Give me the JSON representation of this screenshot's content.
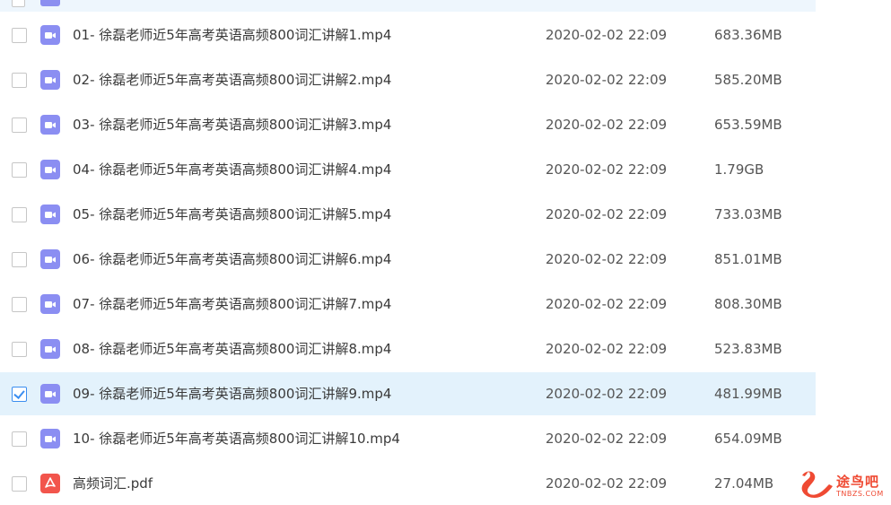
{
  "files": [
    {
      "name": "01- 徐磊老师近5年高考英语高频800词汇讲解1.mp4",
      "date": "2020-02-02 22:09",
      "size": "683.36MB",
      "type": "video",
      "checked": false
    },
    {
      "name": "02- 徐磊老师近5年高考英语高频800词汇讲解2.mp4",
      "date": "2020-02-02 22:09",
      "size": "585.20MB",
      "type": "video",
      "checked": false
    },
    {
      "name": "03- 徐磊老师近5年高考英语高频800词汇讲解3.mp4",
      "date": "2020-02-02 22:09",
      "size": "653.59MB",
      "type": "video",
      "checked": false
    },
    {
      "name": "04- 徐磊老师近5年高考英语高频800词汇讲解4.mp4",
      "date": "2020-02-02 22:09",
      "size": "1.79GB",
      "type": "video",
      "checked": false
    },
    {
      "name": "05- 徐磊老师近5年高考英语高频800词汇讲解5.mp4",
      "date": "2020-02-02 22:09",
      "size": "733.03MB",
      "type": "video",
      "checked": false
    },
    {
      "name": "06- 徐磊老师近5年高考英语高频800词汇讲解6.mp4",
      "date": "2020-02-02 22:09",
      "size": "851.01MB",
      "type": "video",
      "checked": false
    },
    {
      "name": "07- 徐磊老师近5年高考英语高频800词汇讲解7.mp4",
      "date": "2020-02-02 22:09",
      "size": "808.30MB",
      "type": "video",
      "checked": false
    },
    {
      "name": "08- 徐磊老师近5年高考英语高频800词汇讲解8.mp4",
      "date": "2020-02-02 22:09",
      "size": "523.83MB",
      "type": "video",
      "checked": false
    },
    {
      "name": "09- 徐磊老师近5年高考英语高频800词汇讲解9.mp4",
      "date": "2020-02-02 22:09",
      "size": "481.99MB",
      "type": "video",
      "checked": true
    },
    {
      "name": "10- 徐磊老师近5年高考英语高频800词汇讲解10.mp4",
      "date": "2020-02-02 22:09",
      "size": "654.09MB",
      "type": "video",
      "checked": false
    },
    {
      "name": "高频词汇.pdf",
      "date": "2020-02-02 22:09",
      "size": "27.04MB",
      "type": "pdf",
      "checked": false
    }
  ],
  "watermark": {
    "title": "途鸟吧",
    "subtitle": "TNBZS.COM"
  },
  "colors": {
    "selected_row_bg": "#e3f2fc",
    "video_icon": "#8b8ef2",
    "pdf_icon": "#f2554c",
    "checkbox_checked": "#3b8ef0",
    "watermark": "#ef4a33"
  },
  "icons": {
    "video": "video-file-icon",
    "pdf": "pdf-file-icon"
  }
}
